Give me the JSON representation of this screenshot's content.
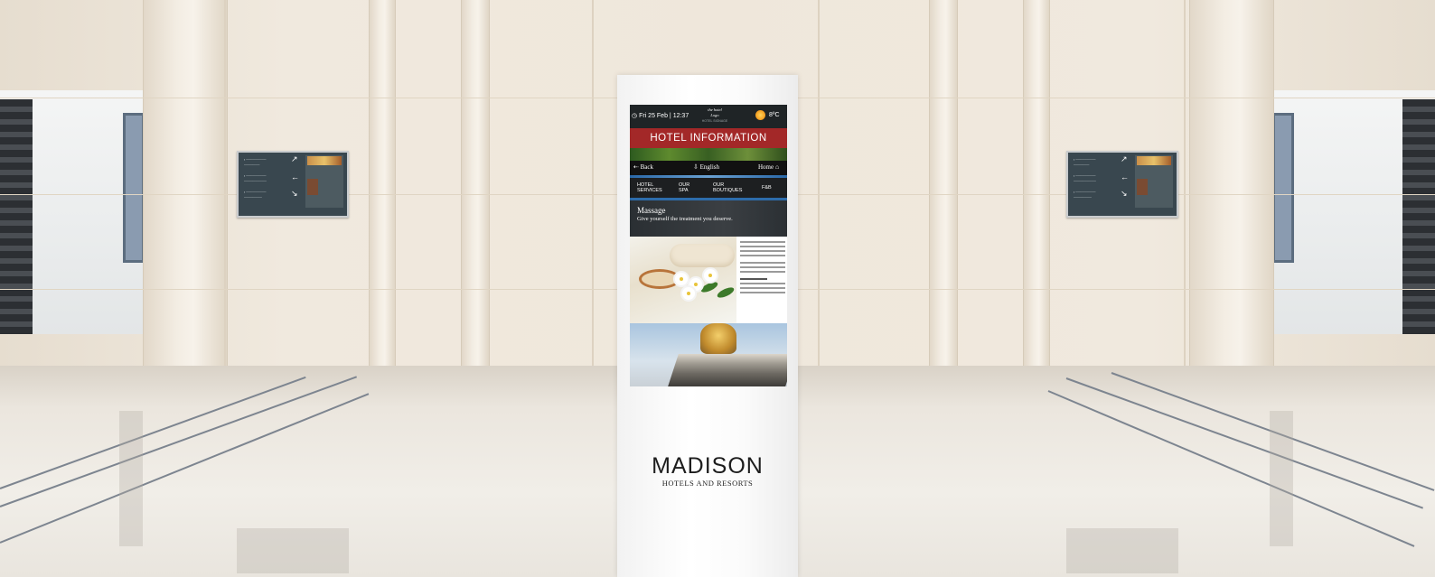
{
  "kiosk_screen": {
    "topbar": {
      "date": "Fri 25 Feb",
      "time": "12:37",
      "logo_line1": "the hotel",
      "logo_line2": "Logo",
      "logo_line3": "HOTEL SIGNAGE",
      "temperature": "8ºC"
    },
    "banner_title": "HOTEL INFORMATION",
    "nav": {
      "back": "Back",
      "language": "English",
      "home": "Home"
    },
    "tabs": [
      {
        "line1": "HOTEL",
        "line2": "SERVICES"
      },
      {
        "line1": "OUR",
        "line2": "SPA"
      },
      {
        "line1": "OUR",
        "line2": "BOUTIQUES"
      },
      {
        "line1": "F&B",
        "line2": ""
      }
    ],
    "hero": {
      "title": "Massage",
      "subtitle": "Give yourself the treatment you deserve."
    }
  },
  "brand": {
    "name": "MADISON",
    "tagline": "HOTELS AND RESORTS"
  },
  "icons": [
    "calendar-icon",
    "sun-icon",
    "back-arrow-icon",
    "language-icon",
    "home-icon",
    "direction-arrow-icon"
  ]
}
